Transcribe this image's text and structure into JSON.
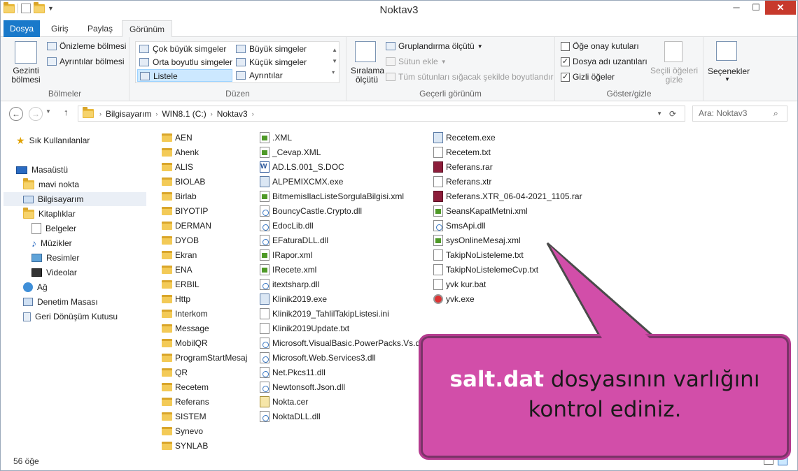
{
  "window": {
    "title": "Noktav3",
    "minimize": "─",
    "maximize": "☐",
    "close": "✕"
  },
  "tabs": {
    "file": "Dosya",
    "home": "Giriş",
    "share": "Paylaş",
    "view": "Görünüm"
  },
  "ribbon": {
    "panes": {
      "nav": "Gezinti bölmesi",
      "preview": "Önizleme bölmesi",
      "details": "Ayrıntılar bölmesi",
      "group": "Bölmeler"
    },
    "layout": {
      "xl": "Çok büyük simgeler",
      "large": "Büyük simgeler",
      "medium": "Orta boyutlu simgeler",
      "small": "Küçük simgeler",
      "list": "Listele",
      "details": "Ayrıntılar",
      "group": "Düzen"
    },
    "current": {
      "sort": "Sıralama ölçütü",
      "groupby": "Gruplandırma ölçütü",
      "addcol": "Sütun ekle",
      "fit": "Tüm sütunları sığacak şekilde boyutlandır",
      "group": "Geçerli görünüm"
    },
    "showhide": {
      "checkboxes": "Öğe onay kutuları",
      "ext": "Dosya adı uzantıları",
      "hidden": "Gizli öğeler",
      "hidesel": "Seçili öğeleri gizle",
      "group": "Göster/gizle"
    },
    "options": "Seçenekler"
  },
  "address": {
    "crumbs": [
      "Bilgisayarım",
      "WIN8.1 (C:)",
      "Noktav3"
    ],
    "search_placeholder": "Ara: Noktav3"
  },
  "nav": {
    "favorites": "Sık Kullanılanlar",
    "desktop": "Masaüstü",
    "user": "mavi nokta",
    "computer": "Bilgisayarım",
    "libraries": "Kitaplıklar",
    "docs": "Belgeler",
    "music": "Müzikler",
    "pictures": "Resimler",
    "videos": "Videolar",
    "network": "Ağ",
    "control": "Denetim Masası",
    "recycle": "Geri Dönüşüm Kutusu"
  },
  "files": {
    "col1": [
      "AEN",
      "Ahenk",
      "ALIS",
      "BIOLAB",
      "Birlab",
      "BIYOTIP",
      "DERMAN",
      "DYOB",
      "Ekran",
      "ENA",
      "ERBIL",
      "Http",
      "Interkom",
      "Message",
      "MobilQR",
      "ProgramStartMesaj",
      "QR",
      "Recetem",
      "Referans",
      "SISTEM",
      "Synevo",
      "SYNLAB"
    ],
    "col2": [
      ".XML",
      "_Cevap.XML",
      "AD.LS.001_S.DOC",
      "ALPEMIXCMX.exe",
      "BitmemisIlacListeSorgulaBilgisi.xml",
      "BouncyCastle.Crypto.dll",
      "EdocLib.dll",
      "EFaturaDLL.dll",
      "IRapor.xml",
      "IRecete.xml",
      "itextsharp.dll",
      "Klinik2019.exe",
      "Klinik2019_TahlilTakipListesi.ini",
      "Klinik2019Update.txt",
      "Microsoft.VisualBasic.PowerPacks.Vs.dll",
      "Microsoft.Web.Services3.dll",
      "Net.Pkcs11.dll",
      "Newtonsoft.Json.dll",
      "Nokta.cer",
      "NoktaDLL.dll"
    ],
    "col3": [
      "Recetem.exe",
      "Recetem.txt",
      "Referans.rar",
      "Referans.xtr",
      "Referans.XTR_06-04-2021_1105.rar",
      "SeansKapatMetni.xml",
      "SmsApi.dll",
      "sysOnlineMesaj.xml",
      "TakipNoListeleme.txt",
      "TakipNoListelemeCvp.txt",
      "yvk kur.bat",
      "yvk.exe"
    ]
  },
  "status": {
    "count": "56 öğe"
  },
  "callout": {
    "bold": "salt.dat",
    "rest1": " dosyasının varlığını",
    "rest2": "kontrol ediniz."
  }
}
